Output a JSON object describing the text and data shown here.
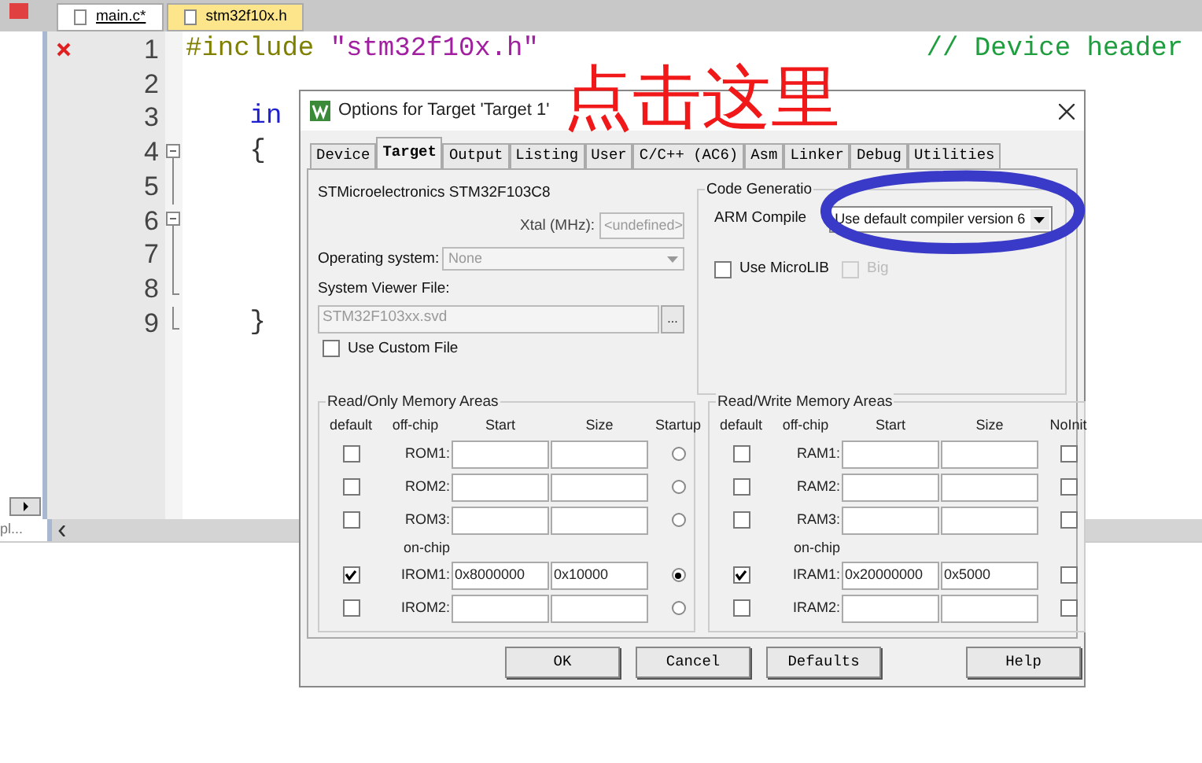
{
  "editor_tabs": [
    {
      "label": "main.c*",
      "selected": true
    },
    {
      "label": "stm32f10x.h",
      "selected": false
    }
  ],
  "project_pane": {
    "label": "pl..."
  },
  "code_lines": [
    {
      "number": "1",
      "error": true,
      "kind": "plain",
      "segments": [
        {
          "kind": "directive",
          "text": "#include "
        },
        {
          "kind": "string",
          "text": "\"stm32f10x.h\""
        },
        {
          "kind": "comment",
          "text": "// Device header"
        }
      ]
    },
    {
      "number": "2",
      "error": false,
      "kind": "plain"
    },
    {
      "number": "3",
      "error": false,
      "kind": "plain",
      "segments": [
        {
          "kind": "keyword",
          "text": "    in"
        }
      ]
    },
    {
      "number": "4",
      "error": false,
      "kind": "fold-open",
      "segments": [
        {
          "kind": "plain",
          "text": "    {"
        }
      ]
    },
    {
      "number": "5",
      "error": false,
      "kind": "fold-line"
    },
    {
      "number": "6",
      "error": false,
      "kind": "fold-open"
    },
    {
      "number": "7",
      "error": false,
      "kind": "fold-line"
    },
    {
      "number": "8",
      "error": false,
      "kind": "fold-end"
    },
    {
      "number": "9",
      "error": false,
      "kind": "fold-end",
      "segments": [
        {
          "kind": "plain",
          "text": "    }"
        }
      ]
    }
  ],
  "dialog": {
    "title": "Options for Target 'Target 1'",
    "tabs": [
      {
        "label": "Device",
        "selected": false
      },
      {
        "label": "Target",
        "selected": true
      },
      {
        "label": "Output",
        "selected": false
      },
      {
        "label": "Listing",
        "selected": false
      },
      {
        "label": "User",
        "selected": false
      },
      {
        "label": "C/C++ (AC6)",
        "selected": false
      },
      {
        "label": "Asm",
        "selected": false
      },
      {
        "label": "Linker",
        "selected": false
      },
      {
        "label": "Debug",
        "selected": false
      },
      {
        "label": "Utilities",
        "selected": false
      }
    ],
    "device": "STMicroelectronics STM32F103C8",
    "xtal": {
      "label": "Xtal (MHz):",
      "value": "<undefined>",
      "disabled": true
    },
    "operating_system": {
      "label": "Operating system:",
      "value": "None",
      "disabled": true
    },
    "system_viewer_file": {
      "label": "System Viewer File:",
      "value": "STM32F103xx.svd",
      "disabled": true,
      "browse": "..."
    },
    "use_custom_file": {
      "label": "Use Custom File",
      "checked": false
    },
    "code_generation": {
      "title": "Code Generatio",
      "compiler_label": "ARM Compile",
      "compiler_value": "Use default compiler version 6",
      "options": [
        {
          "label": "Use MicroLIB",
          "checked": false,
          "disabled": false
        },
        {
          "label": "Big",
          "checked": false,
          "disabled": true
        }
      ]
    },
    "rom": {
      "title": "Read/Only Memory Areas",
      "headers": [
        "default",
        "off-chip",
        "Start",
        "Size",
        "Startup"
      ],
      "on_chip_label": "on-chip",
      "off_chip_rows": [
        {
          "label": "ROM1:",
          "default": false,
          "startup": false
        },
        {
          "label": "ROM2:",
          "default": false,
          "startup": false
        },
        {
          "label": "ROM3:",
          "default": false,
          "startup": false
        }
      ],
      "on_chip_rows": [
        {
          "label": "IROM1:",
          "default": true,
          "start": "0x8000000",
          "size": "0x10000",
          "startup": true
        },
        {
          "label": "IROM2:",
          "default": false,
          "startup": false
        }
      ]
    },
    "ram": {
      "title": "Read/Write Memory Areas",
      "headers": [
        "default",
        "off-chip",
        "Start",
        "Size",
        "NoInit"
      ],
      "on_chip_label": "on-chip",
      "off_chip_rows": [
        {
          "label": "RAM1:",
          "default": false,
          "no_init": false
        },
        {
          "label": "RAM2:",
          "default": false,
          "no_init": false
        },
        {
          "label": "RAM3:",
          "default": false,
          "no_init": false
        }
      ],
      "on_chip_rows": [
        {
          "label": "IRAM1:",
          "default": true,
          "start": "0x20000000",
          "size": "0x5000",
          "no_init": false
        },
        {
          "label": "IRAM2:",
          "default": false,
          "no_init": false
        }
      ]
    },
    "buttons": [
      "OK",
      "Cancel",
      "Defaults",
      "Help"
    ]
  },
  "annotation": {
    "text": "点击这里"
  }
}
